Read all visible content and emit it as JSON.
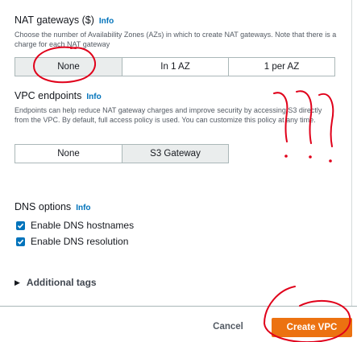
{
  "nat": {
    "title": "NAT gateways ($)",
    "info": "Info",
    "description": "Choose the number of Availability Zones (AZs) in which to create NAT gateways. Note that there is a charge for each NAT gateway",
    "options": [
      "None",
      "In 1 AZ",
      "1 per AZ"
    ],
    "selected": "None"
  },
  "vpce": {
    "title": "VPC endpoints",
    "info": "Info",
    "description": "Endpoints can help reduce NAT gateway charges and improve security by accessing S3 directly from the VPC. By default, full access policy is used. You can customize this policy at any time.",
    "options": [
      "None",
      "S3 Gateway"
    ],
    "selected": "S3 Gateway"
  },
  "dns": {
    "title": "DNS options",
    "info": "Info",
    "hostnames_label": "Enable DNS hostnames",
    "hostnames_checked": true,
    "resolution_label": "Enable DNS resolution",
    "resolution_checked": true
  },
  "additional_tags": {
    "label": "Additional tags"
  },
  "footer": {
    "cancel_label": "Cancel",
    "create_label": "Create VPC"
  },
  "colors": {
    "accent": "#0073bb",
    "primary_button": "#ec7211",
    "annotation": "#e0001a"
  },
  "icons": {
    "checkbox": "check-icon",
    "expand": "caret-right-icon"
  }
}
